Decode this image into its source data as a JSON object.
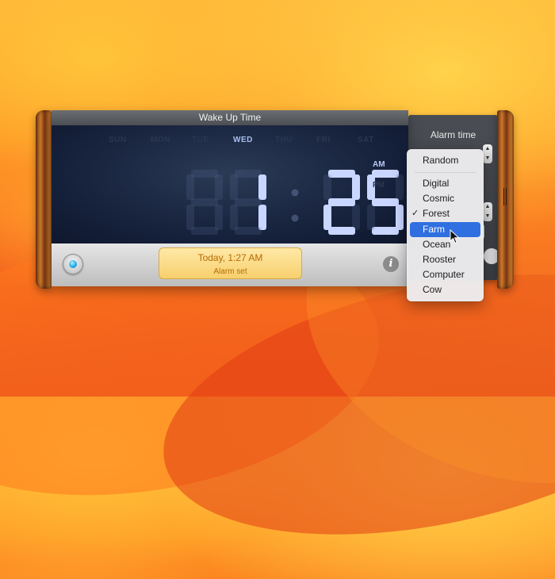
{
  "widget": {
    "title": "Wake Up Time",
    "days": [
      {
        "label": "SUN",
        "active": false
      },
      {
        "label": "MON",
        "active": false
      },
      {
        "label": "TUE",
        "active": false
      },
      {
        "label": "WED",
        "active": true
      },
      {
        "label": "THU",
        "active": false
      },
      {
        "label": "FRI",
        "active": false
      },
      {
        "label": "SAT",
        "active": false
      }
    ],
    "time": {
      "hours": "1",
      "minutes": "25"
    },
    "am_label": "AM",
    "pm_label": "PM",
    "meridiem_active": "AM",
    "alarm_time": "Today, 1:27 AM",
    "alarm_status": "Alarm set",
    "info_glyph": "i",
    "colors": {
      "digit": "#c9d6ff",
      "display_bg": "#15203a",
      "alarm_text": "#b66a00",
      "led": "#1aa6e6"
    }
  },
  "back_panel": {
    "label": "Alarm time"
  },
  "sound_menu": {
    "items": [
      {
        "label": "Random",
        "checked": false,
        "highlighted": false
      },
      {
        "label": "Digital",
        "checked": false,
        "highlighted": false
      },
      {
        "label": "Cosmic",
        "checked": false,
        "highlighted": false
      },
      {
        "label": "Forest",
        "checked": true,
        "highlighted": false
      },
      {
        "label": "Farm",
        "checked": false,
        "highlighted": true
      },
      {
        "label": "Ocean",
        "checked": false,
        "highlighted": false
      },
      {
        "label": "Rooster",
        "checked": false,
        "highlighted": false
      },
      {
        "label": "Computer",
        "checked": false,
        "highlighted": false
      },
      {
        "label": "Cow",
        "checked": false,
        "highlighted": false
      }
    ],
    "check_glyph": "✓",
    "highlight_color": "#2f6fe0"
  }
}
